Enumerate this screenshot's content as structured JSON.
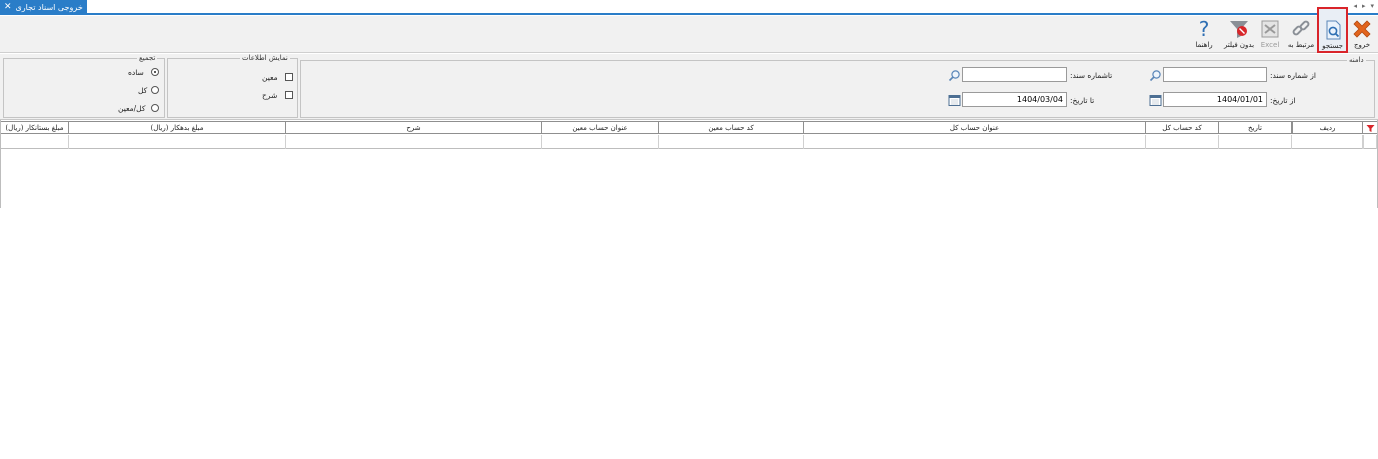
{
  "tab": {
    "title": "خروجی اسناد تجاری",
    "close_glyph": "✕"
  },
  "tab_nav": {
    "prev": "◂",
    "next": "▸",
    "menu": "▾"
  },
  "toolbar": {
    "exit_label": "خروج",
    "search_label": "جستجو",
    "related_label": "مرتبط به",
    "excel_label": "Excel",
    "nofilter_label": "بدون فیلتر",
    "help_label": "راهنما"
  },
  "criteria": {
    "range_legend": "دامنه",
    "from_doc_label": "از شماره سند:",
    "from_doc_value": "",
    "to_doc_label": "تاشماره سند:",
    "to_doc_value": "",
    "from_date_label": "از تاریخ:",
    "from_date_value": "1404/01/01",
    "to_date_label": "تا تاریخ:",
    "to_date_value": "1404/03/04",
    "display_legend": "نمایش اطلاعات",
    "display_options": [
      "معین",
      "شرح"
    ],
    "group_legend": "تجمیع",
    "group_options": [
      "ساده",
      "کل",
      "کل/معین"
    ],
    "group_selected": 0
  },
  "grid": {
    "columns": [
      "ردیف",
      "تاریخ",
      "کد حساب کل",
      "عنوان حساب کل",
      "کد حساب معین",
      "عنوان حساب معین",
      "شرح",
      "مبلغ بدهکار (ریال)",
      "مبلغ بستانکار (ریال)"
    ]
  },
  "colors": {
    "accent": "#2a7dc8",
    "highlight": "#d9242a",
    "exit": "#e2641c",
    "filter": "#d8262a"
  }
}
